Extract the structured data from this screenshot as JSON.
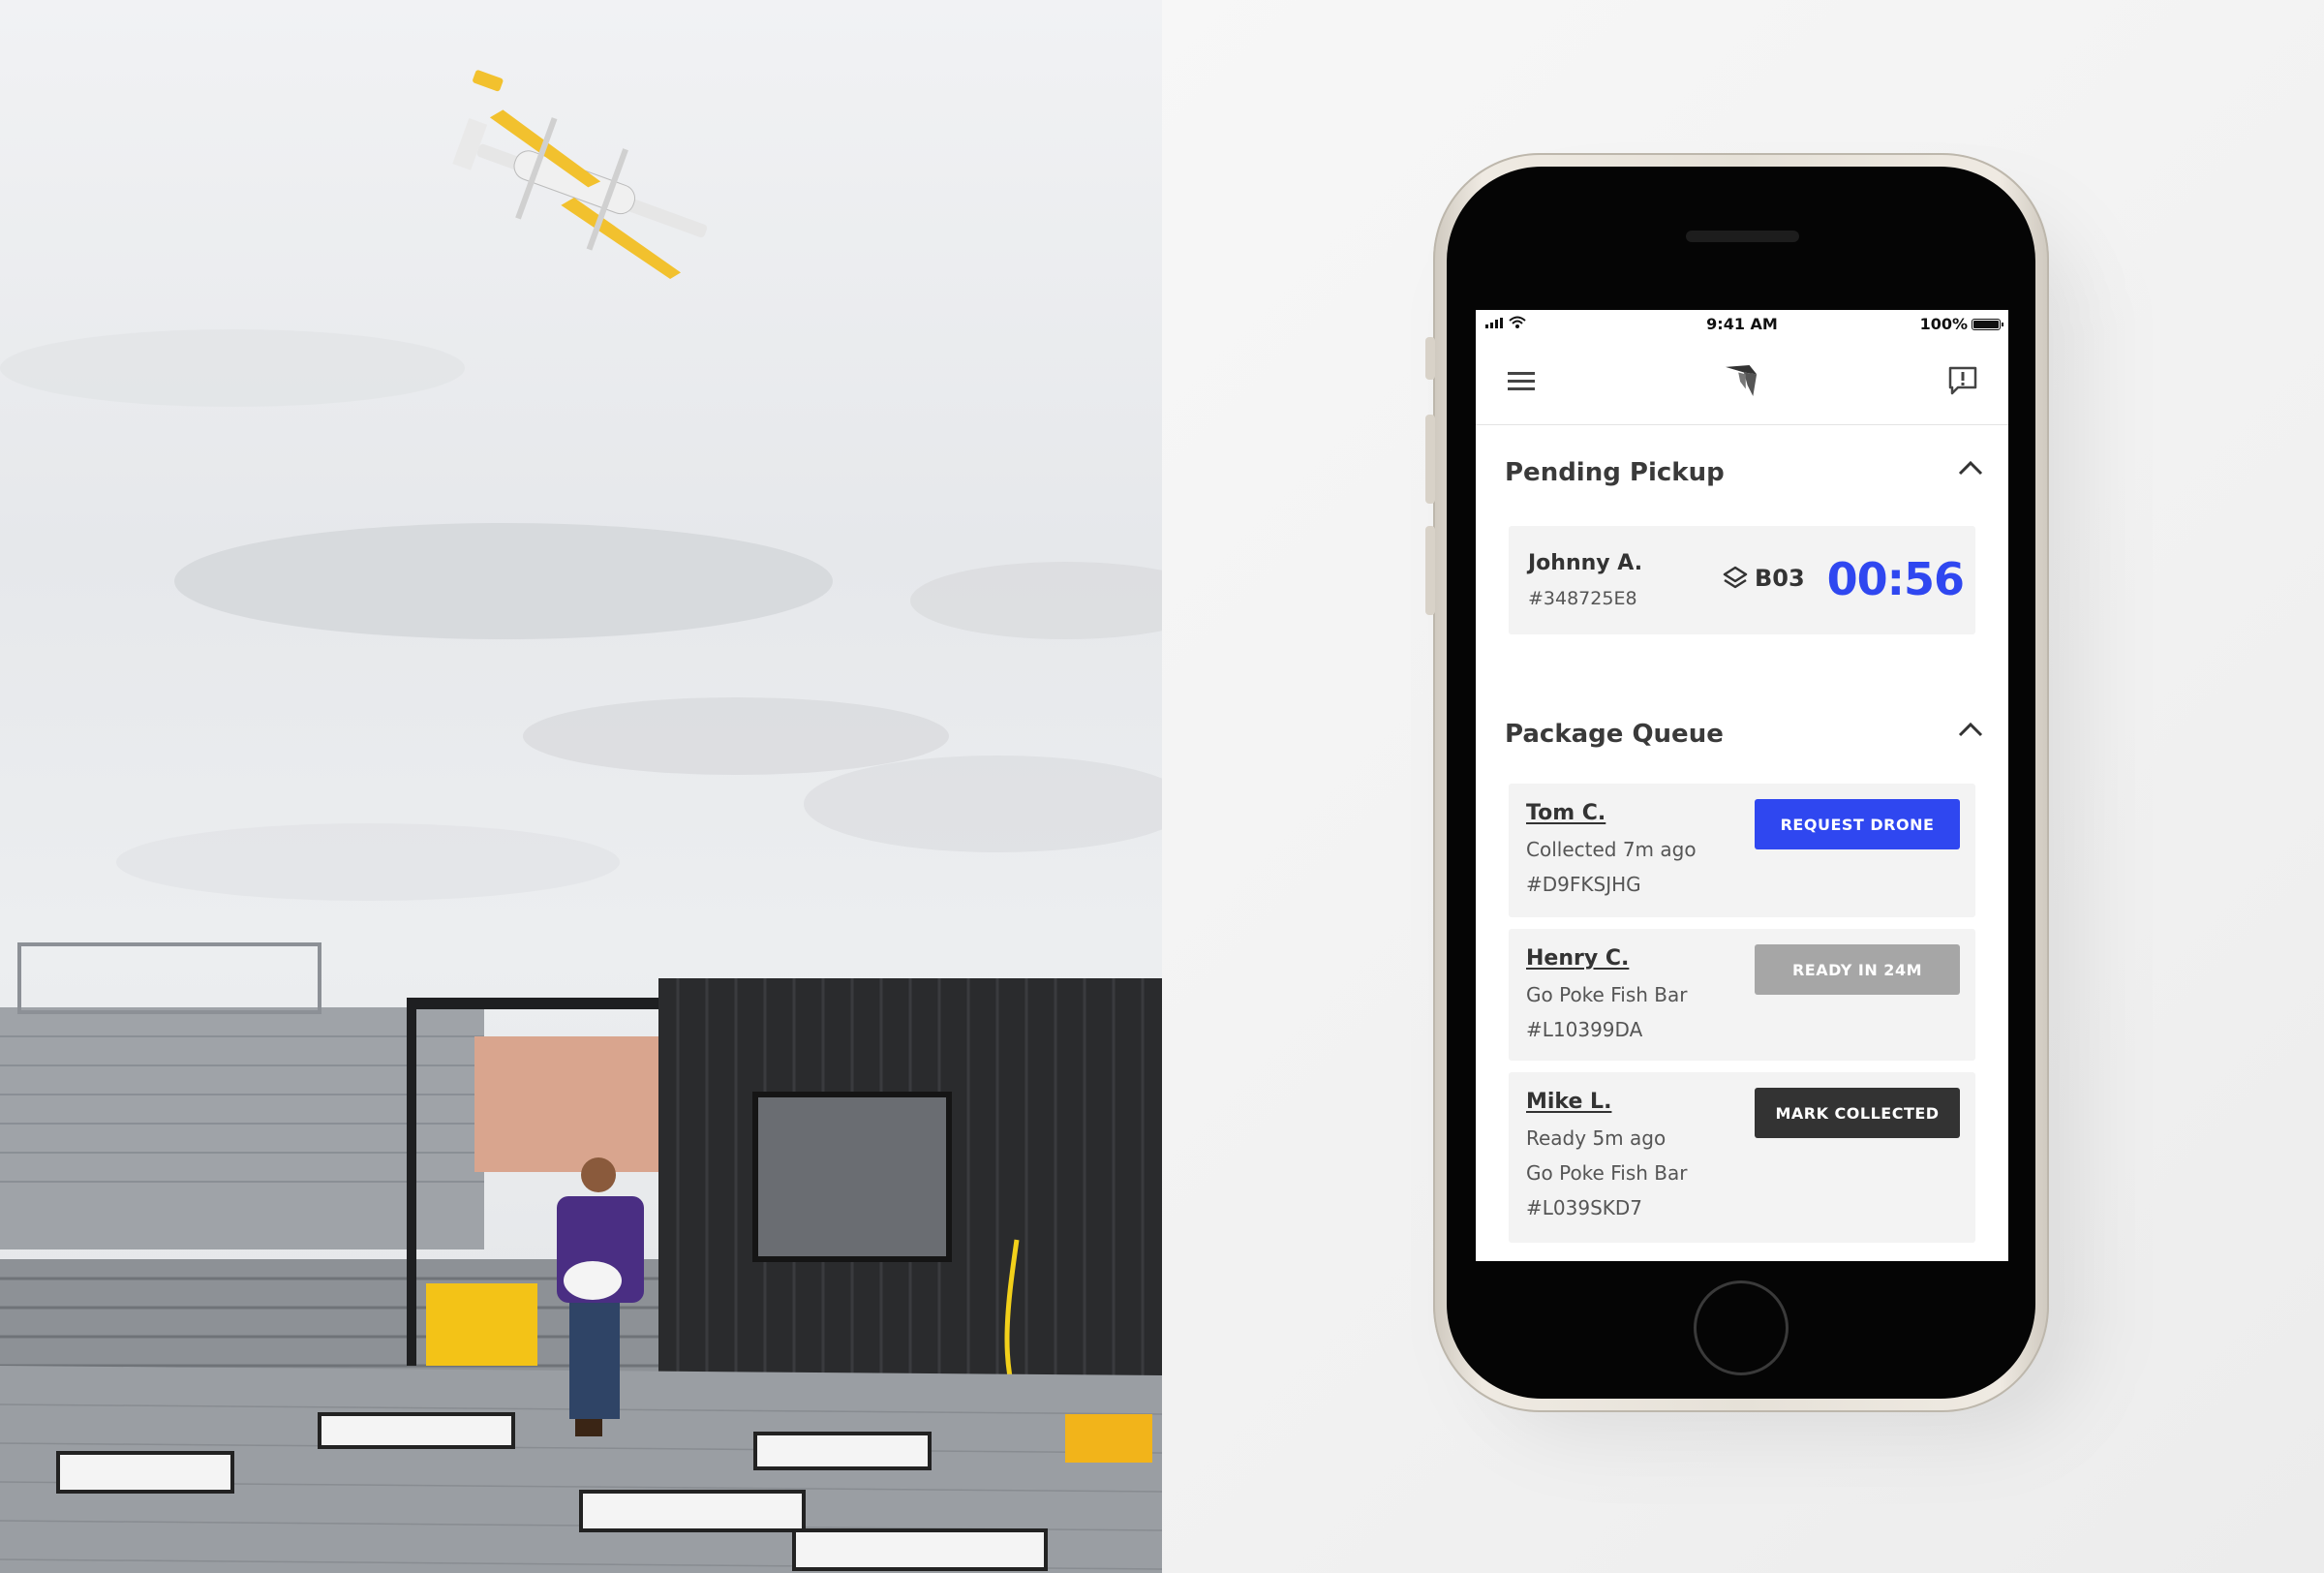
{
  "status_bar": {
    "time": "9:41 AM",
    "battery": "100%"
  },
  "nav": {
    "menu_icon": "hamburger-menu-icon",
    "logo_icon": "wing-logo-icon",
    "feedback_icon": "feedback-icon"
  },
  "pending_pickup": {
    "title": "Pending Pickup",
    "item": {
      "name": "Johnny A.",
      "order_id": "#348725E8",
      "bay": "B03",
      "timer": "00:56"
    }
  },
  "package_queue": {
    "title": "Package Queue",
    "items": [
      {
        "name": "Tom C.",
        "lines": [
          "Collected 7m ago",
          "#D9FKSJHG"
        ],
        "action": "REQUEST DRONE",
        "action_color": "#2f47f0"
      },
      {
        "name": "Henry C.",
        "lines": [
          "Go Poke Fish Bar",
          "#L10399DA"
        ],
        "action": "READY IN 24M",
        "action_color": "#a6a6a6"
      },
      {
        "name": "Mike L.",
        "lines": [
          "Ready 5m ago",
          "Go Poke Fish Bar",
          "#L039SKD7"
        ],
        "action": "MARK COLLECTED",
        "action_color": "#333333"
      }
    ]
  },
  "colors": {
    "accent": "#2f47f0",
    "drone_yellow": "#f2c12e",
    "card_bg": "#f3f3f3"
  }
}
